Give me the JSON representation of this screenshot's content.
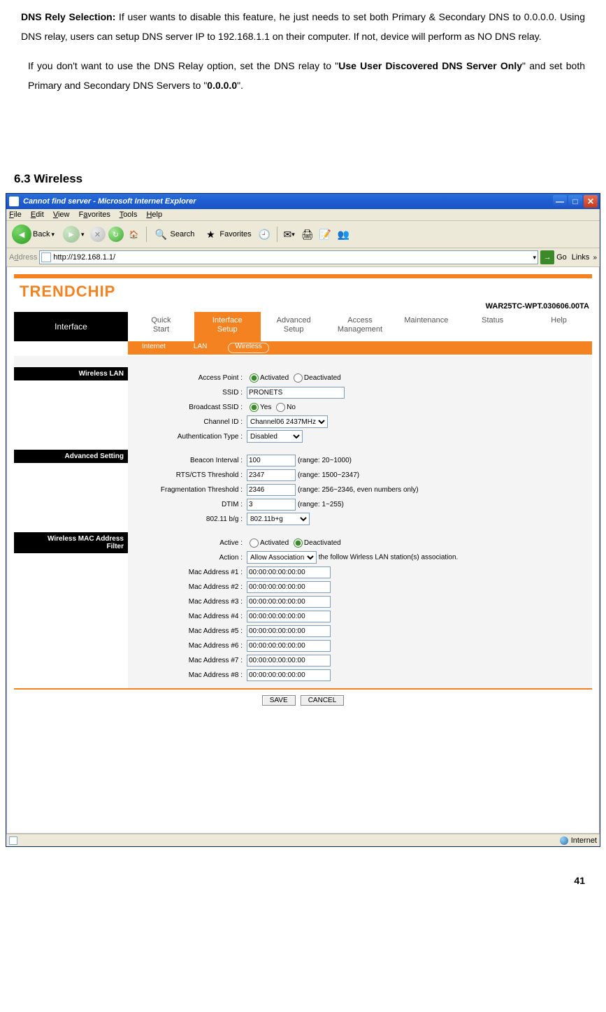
{
  "doc": {
    "p1_bold": "DNS Rely Selection:",
    "p1_rest": " If user wants to disable this feature, he just needs to set both Primary & Secondary DNS to 0.0.0.0. Using DNS relay, users can setup DNS server IP to 192.168.1.1 on their computer. If not, device will perform as NO DNS relay.",
    "p2_a": "If you don't want to use the DNS Relay option, set the DNS relay to \"",
    "p2_b": "Use User Discovered DNS Server Only",
    "p2_c": "\" and set both Primary and Secondary DNS Servers to \"",
    "p2_d": "0.0.0.0",
    "p2_e": "\".",
    "section": "6.3 Wireless"
  },
  "window": {
    "title": "Cannot find server - Microsoft Internet Explorer",
    "menu": [
      "File",
      "Edit",
      "View",
      "Favorites",
      "Tools",
      "Help"
    ],
    "back": "Back",
    "search": "Search",
    "favorites": "Favorites",
    "address_label": "Address",
    "address_value": "http://192.168.1.1/",
    "go": "Go",
    "links": "Links",
    "status": "Internet"
  },
  "page": {
    "brand": "TRENDCHIP",
    "version": "WAR25TC-WPT.030606.00TA",
    "side_label": "Interface",
    "tabs": {
      "quick": "Quick\nStart",
      "iface": "Interface\nSetup",
      "adv": "Advanced\nSetup",
      "access": "Access\nManagement",
      "maint": "Maintenance",
      "status": "Status",
      "help": "Help"
    },
    "subtabs": {
      "internet": "Internet",
      "lan": "LAN",
      "wireless": "Wireless"
    },
    "sec1": "Wireless LAN",
    "sec2": "Advanced Setting",
    "sec3": "Wireless MAC Address\nFilter",
    "wlan": {
      "ap_label": "Access Point :",
      "ap_on": "Activated",
      "ap_off": "Deactivated",
      "ssid_label": "SSID :",
      "ssid_value": "PRONETS",
      "bssid_label": "Broadcast SSID :",
      "bssid_yes": "Yes",
      "bssid_no": "No",
      "chan_label": "Channel ID :",
      "chan_value": "Channel06 2437MHz",
      "auth_label": "Authentication Type :",
      "auth_value": "Disabled"
    },
    "adv": {
      "beacon_label": "Beacon Interval :",
      "beacon_value": "100",
      "beacon_range": "(range: 20~1000)",
      "rts_label": "RTS/CTS Threshold :",
      "rts_value": "2347",
      "rts_range": "(range: 1500~2347)",
      "frag_label": "Fragmentation Threshold :",
      "frag_value": "2346",
      "frag_range": "(range: 256~2346, even numbers only)",
      "dtim_label": "DTIM :",
      "dtim_value": "3",
      "dtim_range": "(range: 1~255)",
      "mode_label": "802.11 b/g :",
      "mode_value": "802.11b+g"
    },
    "filter": {
      "active_label": "Active :",
      "active_on": "Activated",
      "active_off": "Deactivated",
      "action_label": "Action :",
      "action_value": "Allow Association",
      "action_rest": "the follow Wirless LAN station(s) association.",
      "mac_labels": [
        "Mac Address #1 :",
        "Mac Address #2 :",
        "Mac Address #3 :",
        "Mac Address #4 :",
        "Mac Address #5 :",
        "Mac Address #6 :",
        "Mac Address #7 :",
        "Mac Address #8 :"
      ],
      "mac_value": "00:00:00:00:00:00"
    },
    "buttons": {
      "save": "SAVE",
      "cancel": "CANCEL"
    }
  },
  "page_number": "41"
}
